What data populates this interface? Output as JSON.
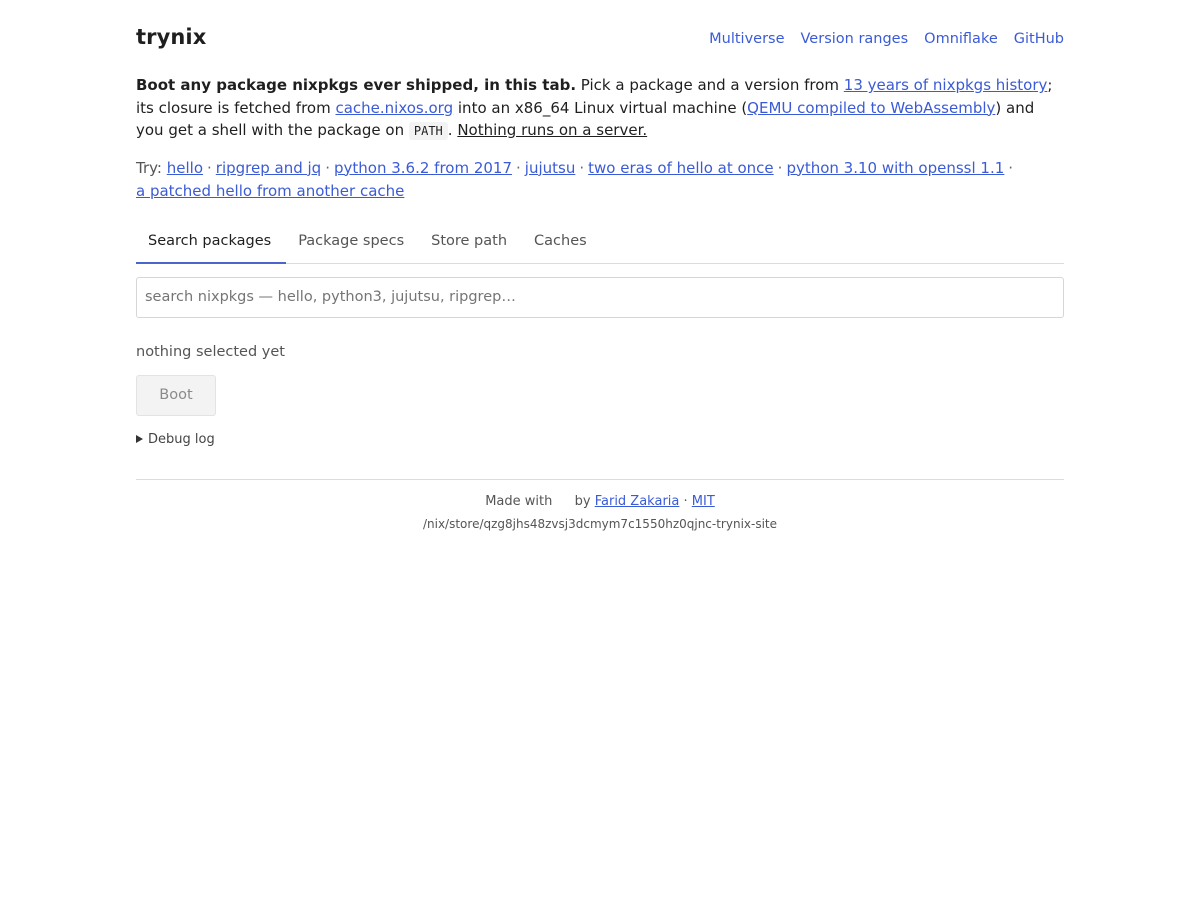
{
  "brand": "trynix",
  "nav": [
    "Multiverse",
    "Version ranges",
    "Omniflake",
    "GitHub"
  ],
  "intro": {
    "lead": "Boot any package nixpkgs ever shipped, in this tab.",
    "p1": " Pick a package and a version from ",
    "history_link": "13 years of nixpkgs history",
    "p2": "; its closure is fetched from ",
    "cache_link": "cache.nixos.org",
    "p3": " into an x86_64 Linux virtual machine (",
    "qemu_link": "QEMU compiled to WebAssembly",
    "p4": ") and you get a shell with the package on ",
    "code": "PATH",
    "p5": ". ",
    "no_server": "Nothing runs on a server."
  },
  "try": {
    "label": "Try:",
    "links": [
      "hello",
      "ripgrep and jq",
      "python 3.6.2 from 2017",
      "jujutsu",
      "two eras of hello at once",
      "python 3.10 with openssl 1.1",
      "a patched hello from another cache"
    ],
    "sep": "·"
  },
  "tabs": [
    "Search packages",
    "Package specs",
    "Store path",
    "Caches"
  ],
  "active_tab": "Search packages",
  "search": {
    "placeholder": "search nixpkgs — hello, python3, jujutsu, ripgrep…",
    "value": ""
  },
  "status": "nothing selected yet",
  "boot_label": "Boot",
  "debug_label": "Debug log",
  "footer": {
    "made_with": "Made with",
    "by": "by",
    "author": "Farid Zakaria",
    "sep": "·",
    "license": "MIT",
    "store_path": "/nix/store/qzg8jhs48zvsj3dcmym7c1550hz0qjnc-trynix-site"
  }
}
